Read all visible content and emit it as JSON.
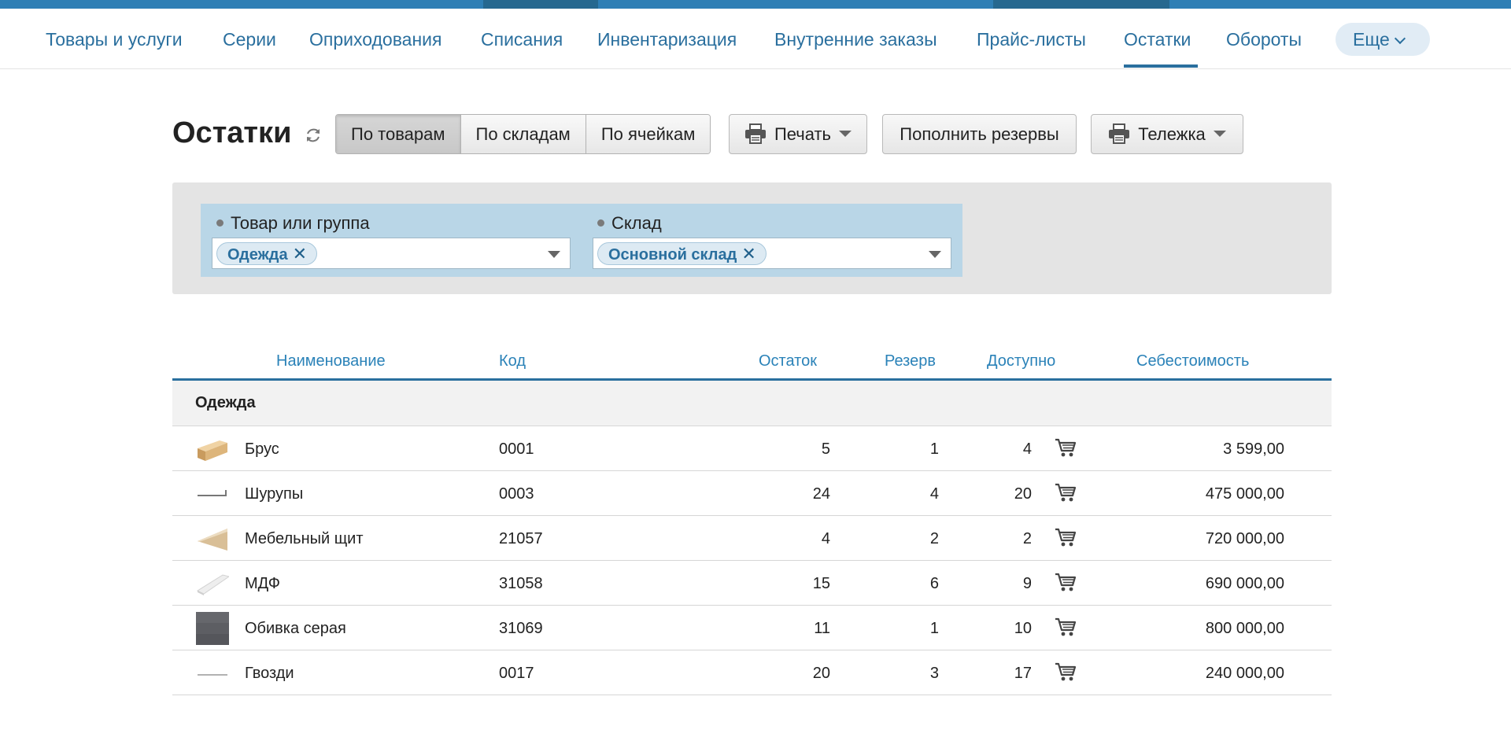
{
  "nav": {
    "items": [
      {
        "label": "Товары и услуги"
      },
      {
        "label": "Серии"
      },
      {
        "label": "Оприходования"
      },
      {
        "label": "Списания"
      },
      {
        "label": "Инвентаризация"
      },
      {
        "label": "Внутренние заказы"
      },
      {
        "label": "Прайс-листы"
      },
      {
        "label": "Остатки",
        "active": true
      },
      {
        "label": "Обороты"
      }
    ],
    "more_label": "Еще"
  },
  "header": {
    "title": "Остатки",
    "view_tabs": [
      {
        "label": "По товарам",
        "selected": true
      },
      {
        "label": "По складам"
      },
      {
        "label": "По ячейкам"
      }
    ],
    "print_label": "Печать",
    "replenish_label": "Пополнить резервы",
    "cart_label": "Тележка"
  },
  "filters": {
    "product": {
      "label": "Товар или группа",
      "chip": "Одежда"
    },
    "warehouse": {
      "label": "Склад",
      "chip": "Основной склад"
    }
  },
  "table": {
    "columns": [
      "Наименование",
      "Код",
      "Остаток",
      "Резерв",
      "Доступно",
      "Себестоимость"
    ],
    "group": "Одежда",
    "rows": [
      {
        "name": "Брус",
        "code": "0001",
        "remainder": "5",
        "reserve": "1",
        "available": "4",
        "cost": "3 599,00",
        "thumb": "beam"
      },
      {
        "name": "Шурупы",
        "code": "0003",
        "remainder": "24",
        "reserve": "4",
        "available": "20",
        "cost": "475 000,00",
        "thumb": "screw"
      },
      {
        "name": "Мебельный щит",
        "code": "21057",
        "remainder": "4",
        "reserve": "2",
        "available": "2",
        "cost": "720 000,00",
        "thumb": "board"
      },
      {
        "name": "МДФ",
        "code": "31058",
        "remainder": "15",
        "reserve": "6",
        "available": "9",
        "cost": "690 000,00",
        "thumb": "mdf"
      },
      {
        "name": "Обивка серая",
        "code": "31069",
        "remainder": "11",
        "reserve": "1",
        "available": "10",
        "cost": "800 000,00",
        "thumb": "fabric"
      },
      {
        "name": "Гвозди",
        "code": "0017",
        "remainder": "20",
        "reserve": "3",
        "available": "17",
        "cost": "240 000,00",
        "thumb": "nail"
      }
    ]
  },
  "colors": {
    "accent": "#2a6f9e",
    "top_strip": "#2f7fb5",
    "filter_box": "#b9d6e7"
  }
}
